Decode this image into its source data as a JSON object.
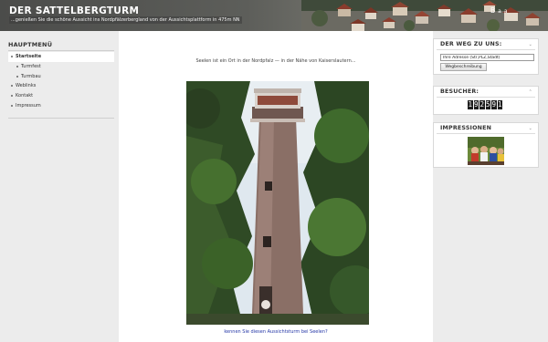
{
  "header": {
    "title": "DER SATTELBERGTURM",
    "subtitle": "...genießen Sie die schöne Aussicht ins Nordpfälzerbergland von der Aussichtsplattform in 475m NN",
    "font_tools": [
      "B",
      "a",
      "a"
    ]
  },
  "sidebar": {
    "heading": "HAUPTMENÜ",
    "items": [
      {
        "label": "Startseite",
        "active": true
      },
      {
        "label": "Turmfest",
        "sub": true
      },
      {
        "label": "Turmbau",
        "sub": true
      },
      {
        "label": "Weblinks"
      },
      {
        "label": "Kontakt"
      },
      {
        "label": "Impressum"
      }
    ]
  },
  "main": {
    "intro": "Seelen ist ein Ort in der Nordpfalz — in der Nähe von Kaiserslautern...",
    "caption": "kennen Sie diesen Aussichtsturm bei Seelen?"
  },
  "right": {
    "way": {
      "heading": "DER WEG ZU UNS:",
      "address_value": "Ihre Adresse (Str,PLZ,Stadt)",
      "button": "Wegbeschreibung"
    },
    "visitors": {
      "heading": "BESUCHER:",
      "count": "192591"
    },
    "impressions": {
      "heading": "IMPRESSIONEN"
    }
  },
  "colors": {
    "header_bg": "#4b4c4a",
    "link": "#2436a6",
    "panel_bg": "#ececec"
  }
}
